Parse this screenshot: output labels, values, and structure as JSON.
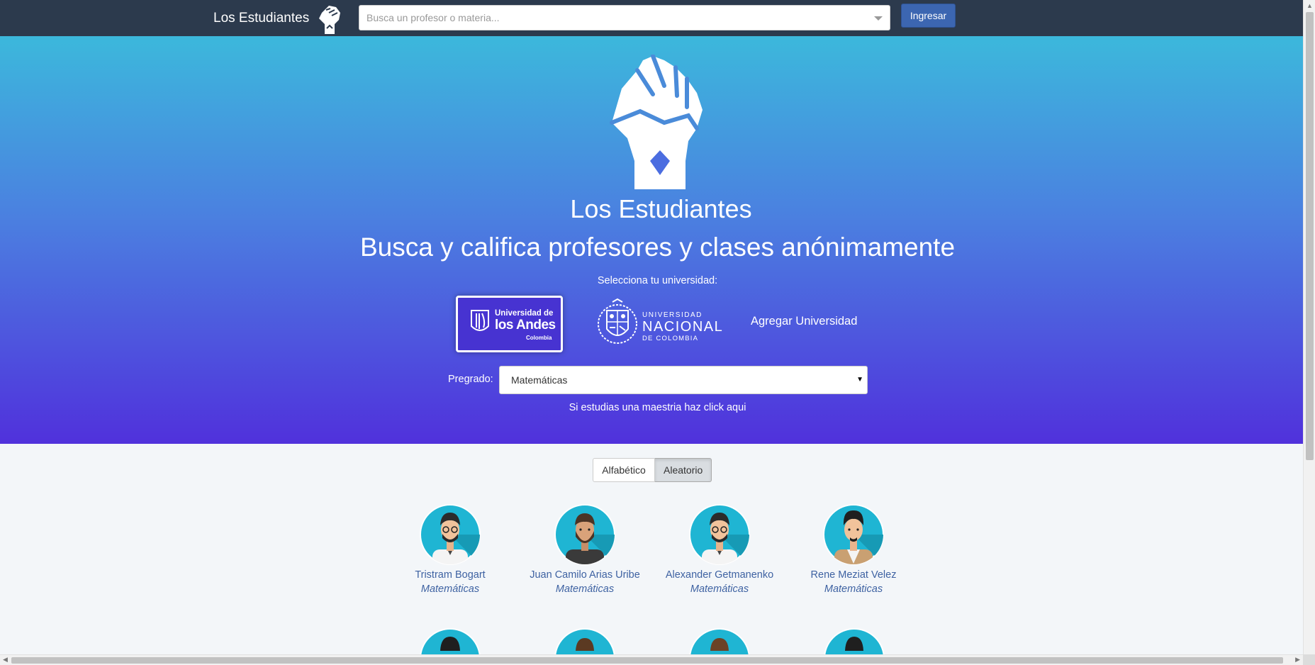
{
  "navbar": {
    "brand": "Los Estudiantes",
    "search_placeholder": "Busca un profesor o materia...",
    "login_label": "Ingresar"
  },
  "hero": {
    "title": "Los Estudiantes",
    "subtitle": "Busca y califica profesores y clases anónimamente",
    "select_university": "Selecciona tu universidad:",
    "universities": [
      {
        "line1": "Universidad de",
        "line2": "los Andes",
        "line3": "Colombia"
      },
      {
        "line1": "UNIVERSIDAD",
        "line2": "NACIONAL",
        "line3": "DE COLOMBIA"
      }
    ],
    "add_university": "Agregar Universidad",
    "pregrado_label": "Pregrado:",
    "pregrado_value": "Matemáticas",
    "maestria_link": "Si estudias una maestria haz click aqui"
  },
  "sort": {
    "alphabetic": "Alfabético",
    "random": "Aleatorio",
    "active": "random"
  },
  "professors": [
    {
      "name": "Tristram Bogart",
      "dept": "Matemáticas"
    },
    {
      "name": "Juan Camilo Arias Uribe",
      "dept": "Matemáticas"
    },
    {
      "name": "Alexander Getmanenko",
      "dept": "Matemáticas"
    },
    {
      "name": "Rene Meziat Velez",
      "dept": "Matemáticas"
    }
  ],
  "colors": {
    "navbar": "#2c3a4d",
    "hero_top": "#3cb8dc",
    "hero_bottom": "#5031dc",
    "accent": "#3c66b1",
    "link": "#3e62a2"
  }
}
